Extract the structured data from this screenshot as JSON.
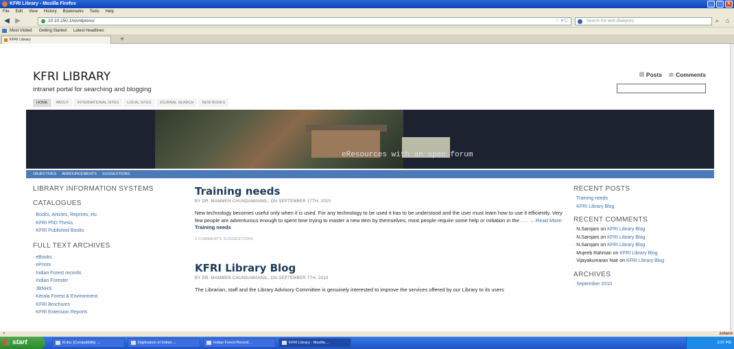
{
  "window": {
    "title": "KFRI Library - Mozilla Firefox"
  },
  "menubar": {
    "items": [
      "File",
      "Edit",
      "View",
      "History",
      "Bookmarks",
      "Tools",
      "Help"
    ]
  },
  "url": "10.10.150.1/wordpress/",
  "search_placeholder": "Search the web (Babylon)",
  "bookmarks": [
    "Most Visited",
    "Getting Started",
    "Latest Headlines"
  ],
  "tab": {
    "label": "KFRI Library",
    "new_tab": "+"
  },
  "site": {
    "title": "KFRI LIBRARY",
    "description": "intranet portal for searching and blogging",
    "feeds": {
      "posts": "Posts",
      "comments": "Comments"
    },
    "nav": [
      "HOME",
      "ABOUT",
      "INTERNATIONAL SITES",
      "LOCAL SITES",
      "JOURNAL SEARCH",
      "NEW BOOKS"
    ],
    "tagline": "eResources with an open forum",
    "subnav": [
      "OBJECTIVES",
      "ANNOUNCEMENTS",
      "SUGGESTIONS"
    ]
  },
  "left_sidebar": {
    "title": "LIBRARY INFORMATION SYSTEMS",
    "catalogues": {
      "heading": "CATALOGUES",
      "items": [
        "Books, Articles, Reprints, etc.",
        "KFRI PhD Thesis",
        "KFRI Published Books"
      ]
    },
    "archives": {
      "heading": "FULL TEXT ARCHIVES",
      "items": [
        "eBooks",
        "ePrints",
        "Indian Forest records",
        "Indian Forester",
        "JBNHS",
        "Kerala Forest & Environment",
        "KFRI Brochures",
        "KFRI Extension Reports"
      ]
    }
  },
  "posts": [
    {
      "title": "Training needs",
      "meta": "BY DR. MAMMEN CHUNDAMANNIL, ON SEPTEMBER 17TH, 2010",
      "body": "New technology becomes useful only when it is used. For any technology to be used it has to be understood and the user must learn how to use it efficiently. Very few people are adventurous enough to spent time trying to master a new item by themselves; most people require some help or initiation in the . . .",
      "more": " → Read More:",
      "more_link": "Training needs",
      "footer": "3 COMMENTS   SUGGESTIONS"
    },
    {
      "title": "KFRI Library Blog",
      "meta": "BY DR. MAMMEN CHUNDAMANNIL, ON SEPTEMBER 7TH, 2010",
      "body": "The Librarian, staff and the Library Advisory Committee is genuinely interested to improve the services offered by our Library to its users"
    }
  ],
  "right_sidebar": {
    "recent_posts": {
      "heading": "RECENT POSTS",
      "items": [
        "Training needs",
        "KFRI Library Blog"
      ]
    },
    "recent_comments": {
      "heading": "RECENT COMMENTS",
      "items": [
        {
          "who": "N.Sarojam",
          "post": "KFRI Library Blog"
        },
        {
          "who": "N.Sarojam",
          "post": "KFRI Library Blog"
        },
        {
          "who": "N.Sarojam",
          "post": "KFRI Library Blog"
        },
        {
          "who": "Mujeeb Rahman",
          "post": "KFRI Library Blog"
        },
        {
          "who": "Vijayakumaran Nair",
          "post": "KFRI Library Blog"
        }
      ],
      "on": "on"
    },
    "archives": {
      "heading": "ARCHIVES",
      "items": [
        "September 2010"
      ]
    }
  },
  "statusbar": {
    "text": "×",
    "zotero": "zotero"
  },
  "taskbar": {
    "start": "start",
    "items": [
      "ill.doc [Compatibility ...",
      "Digitisation of Indian ...",
      "Indian Forest Record...",
      "KFRI Library - Mozilla ..."
    ],
    "clock": "3:37 PM"
  }
}
